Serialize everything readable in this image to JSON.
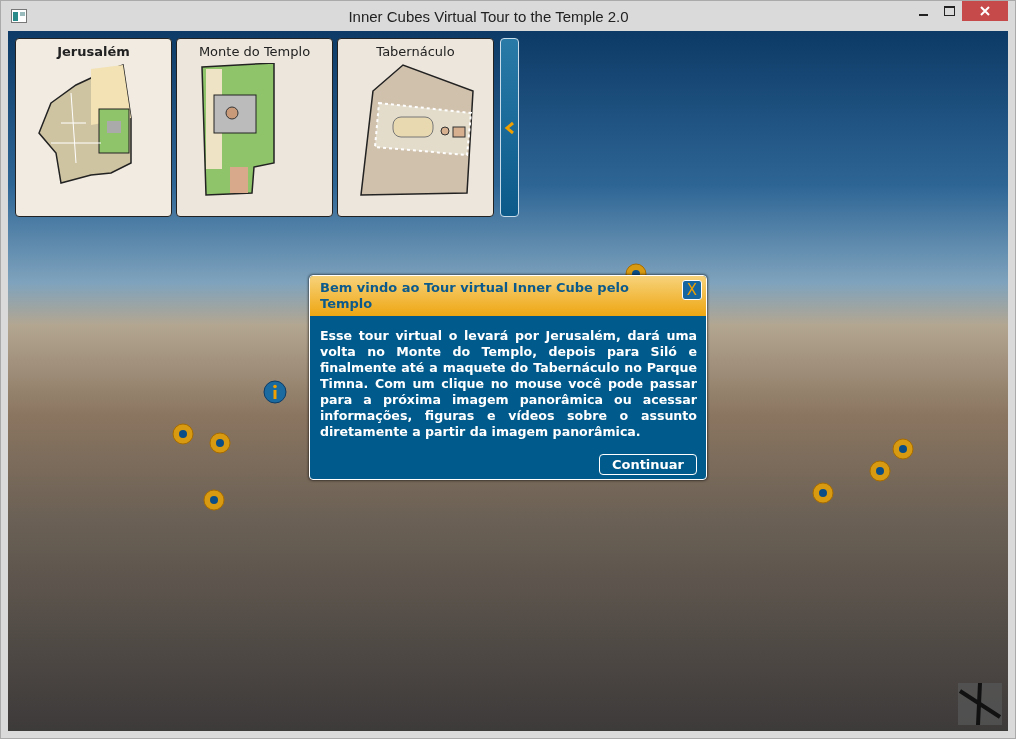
{
  "window": {
    "title": "Inner Cubes Virtual Tour to the Temple 2.0"
  },
  "maps": [
    {
      "label": "Jerusalém",
      "selected": true,
      "kind": "city"
    },
    {
      "label": "Monte do Templo",
      "selected": false,
      "kind": "mount"
    },
    {
      "label": "Tabernáculo",
      "selected": false,
      "kind": "tabernacle"
    }
  ],
  "dialog": {
    "title": "Bem vindo ao Tour virtual Inner Cube pelo Templo",
    "close": "X",
    "body": "Esse tour virtual o levará por Jerusalém, dará uma volta no Monte do Templo, depois para Siló e finalmente até a maquete do Tabernáculo no Parque Timna. Com um clique no mouse você pode passar para a próxima imagem panorâmica ou acessar informações, figuras e vídeos sobre o assunto diretamente a partir da imagem panorâmica.",
    "button": "Continuar"
  }
}
